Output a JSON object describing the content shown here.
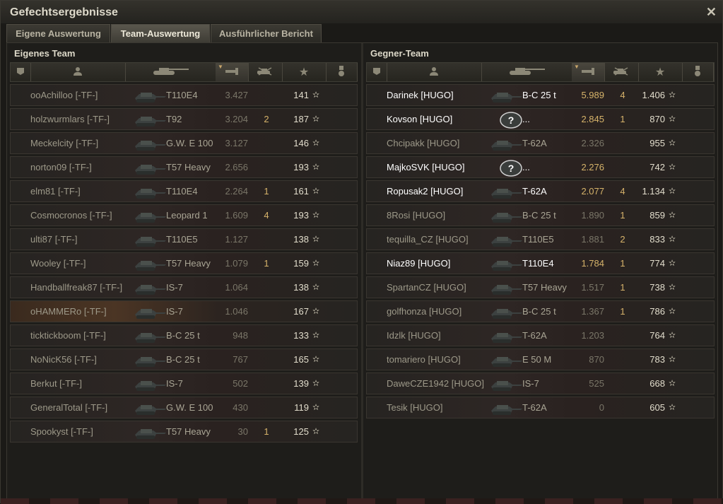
{
  "window": {
    "title": "Gefechtsergebnisse",
    "close_icon": "close-icon"
  },
  "tabs": [
    {
      "label": "Eigene Auswertung",
      "active": false
    },
    {
      "label": "Team-Auswertung",
      "active": true
    },
    {
      "label": "Ausführlicher Bericht",
      "active": false
    }
  ],
  "columns": {
    "icons": [
      "platoon-icon",
      "player-icon",
      "tank-icon",
      "damage-icon",
      "frags-icon",
      "experience-star-icon",
      "medal-icon"
    ],
    "sorted_column": "damage"
  },
  "own_team": {
    "title": "Eigenes Team",
    "players": [
      {
        "name": "ooAchilloo [-TF-]",
        "tank": "T110E4",
        "value": "3.427",
        "kills": "",
        "xp": "141"
      },
      {
        "name": "holzwurmlars [-TF-]",
        "tank": "T92",
        "value": "3.204",
        "kills": "2",
        "xp": "187"
      },
      {
        "name": "Meckelcity [-TF-]",
        "tank": "G.W. E 100",
        "value": "3.127",
        "kills": "",
        "xp": "146"
      },
      {
        "name": "norton09 [-TF-]",
        "tank": "T57 Heavy",
        "value": "2.656",
        "kills": "",
        "xp": "193"
      },
      {
        "name": "elm81 [-TF-]",
        "tank": "T110E4",
        "value": "2.264",
        "kills": "1",
        "xp": "161"
      },
      {
        "name": "Cosmocronos [-TF-]",
        "tank": "Leopard 1",
        "value": "1.609",
        "kills": "4",
        "xp": "193"
      },
      {
        "name": "ulti87 [-TF-]",
        "tank": "T110E5",
        "value": "1.127",
        "kills": "",
        "xp": "138"
      },
      {
        "name": "Wooley [-TF-]",
        "tank": "T57 Heavy",
        "value": "1.079",
        "kills": "1",
        "xp": "159"
      },
      {
        "name": "Handballfreak87 [-TF-]",
        "tank": "IS-7",
        "value": "1.064",
        "kills": "",
        "xp": "138"
      },
      {
        "name": "oHAMMERo [-TF-]",
        "tank": "IS-7",
        "value": "1.046",
        "kills": "",
        "xp": "167",
        "highlight": true
      },
      {
        "name": "ticktickboom [-TF-]",
        "tank": "B-C 25 t",
        "value": "948",
        "kills": "",
        "xp": "133"
      },
      {
        "name": "NoNicK56 [-TF-]",
        "tank": "B-C 25 t",
        "value": "767",
        "kills": "",
        "xp": "165"
      },
      {
        "name": "Berkut [-TF-]",
        "tank": "IS-7",
        "value": "502",
        "kills": "",
        "xp": "139"
      },
      {
        "name": "GeneralTotal [-TF-]",
        "tank": "G.W. E 100",
        "value": "430",
        "kills": "",
        "xp": "119"
      },
      {
        "name": "Spookyst [-TF-]",
        "tank": "T57 Heavy",
        "value": "30",
        "kills": "1",
        "xp": "125"
      }
    ]
  },
  "enemy_team": {
    "title": "Gegner-Team",
    "players": [
      {
        "name": "Darinek [HUGO]",
        "tank": "B-C 25 t",
        "value": "5.989",
        "kills": "4",
        "xp": "1.406",
        "bright": true
      },
      {
        "name": "Kovson [HUGO]",
        "tank": "...",
        "value": "2.845",
        "kills": "1",
        "xp": "870",
        "bright": true,
        "unknown": true
      },
      {
        "name": "Chcipakk [HUGO]",
        "tank": "T-62A",
        "value": "2.326",
        "kills": "",
        "xp": "955"
      },
      {
        "name": "MajkoSVK [HUGO]",
        "tank": "...",
        "value": "2.276",
        "kills": "",
        "xp": "742",
        "bright": true,
        "unknown": true
      },
      {
        "name": "Ropusak2 [HUGO]",
        "tank": "T-62A",
        "value": "2.077",
        "kills": "4",
        "xp": "1.134",
        "bright": true
      },
      {
        "name": "8Rosi [HUGO]",
        "tank": "B-C 25 t",
        "value": "1.890",
        "kills": "1",
        "xp": "859"
      },
      {
        "name": "tequilla_CZ [HUGO]",
        "tank": "T110E5",
        "value": "1.881",
        "kills": "2",
        "xp": "833"
      },
      {
        "name": "Niaz89 [HUGO]",
        "tank": "T110E4",
        "value": "1.784",
        "kills": "1",
        "xp": "774",
        "bright": true
      },
      {
        "name": "SpartanCZ [HUGO]",
        "tank": "T57 Heavy",
        "value": "1.517",
        "kills": "1",
        "xp": "738"
      },
      {
        "name": "golfhonza [HUGO]",
        "tank": "B-C 25 t",
        "value": "1.367",
        "kills": "1",
        "xp": "786"
      },
      {
        "name": "Idzlk [HUGO]",
        "tank": "T-62A",
        "value": "1.203",
        "kills": "",
        "xp": "764"
      },
      {
        "name": "tomariero [HUGO]",
        "tank": "E 50 M",
        "value": "870",
        "kills": "",
        "xp": "783"
      },
      {
        "name": "DaweCZE1942 [HUGO]",
        "tank": "IS-7",
        "value": "525",
        "kills": "",
        "xp": "668"
      },
      {
        "name": "Tesik [HUGO]",
        "tank": "T-62A",
        "value": "0",
        "kills": "",
        "xp": "605"
      }
    ]
  },
  "colors": {
    "accent_gold": "#d6b36a",
    "text_dim": "#9d9989",
    "text_bright": "#ffffff"
  },
  "star_glyph": "✫",
  "unknown_tank_glyph": "?"
}
